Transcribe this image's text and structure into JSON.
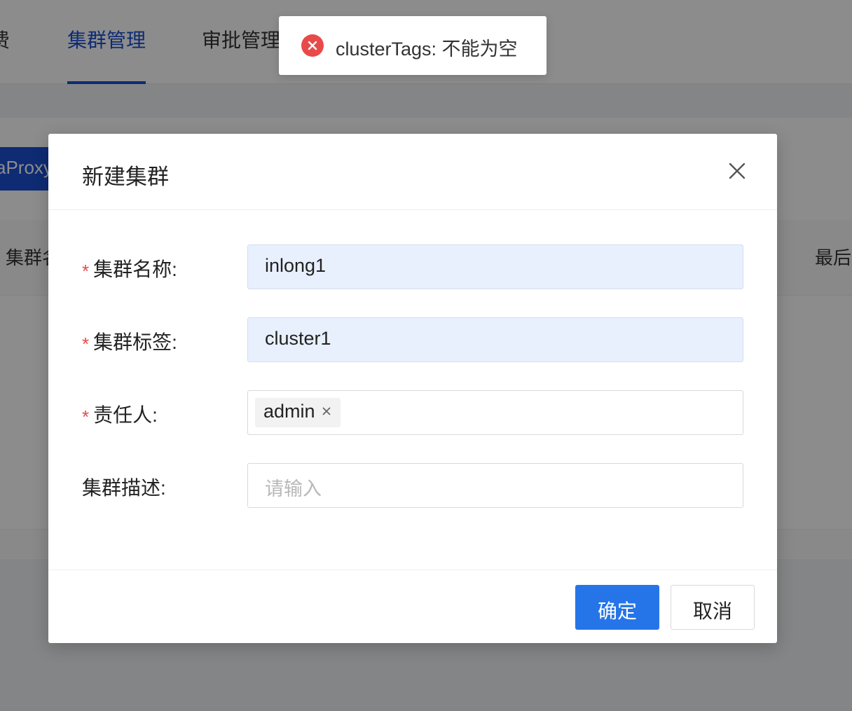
{
  "background": {
    "nav": {
      "partial_item": "费",
      "clusters_tab": "集群管理",
      "approval_tab": "审批管理"
    },
    "tab_button": "aProxy",
    "table": {
      "first_header": "集群名",
      "last_header": "最后"
    }
  },
  "toast": {
    "icon": "error-circle-icon",
    "message": "clusterTags: 不能为空",
    "color": "#e84a4a"
  },
  "modal": {
    "title": "新建集群",
    "close_icon": "close-icon",
    "fields": [
      {
        "label": "集群名称:",
        "required": true,
        "value": "inlong1"
      },
      {
        "label": "集群标签:",
        "required": true,
        "value": "cluster1"
      },
      {
        "label": "责任人:",
        "required": true,
        "tags": [
          "admin"
        ]
      },
      {
        "label": "集群描述:",
        "required": false,
        "value": "",
        "placeholder": "请输入"
      }
    ],
    "required_mark": "*",
    "ok_button": "确定",
    "cancel_button": "取消"
  },
  "colors": {
    "primary": "#2575e8",
    "nav_active": "#1b4fd1",
    "autofill_bg": "#e8f0fe",
    "required": "#e84a4a"
  }
}
